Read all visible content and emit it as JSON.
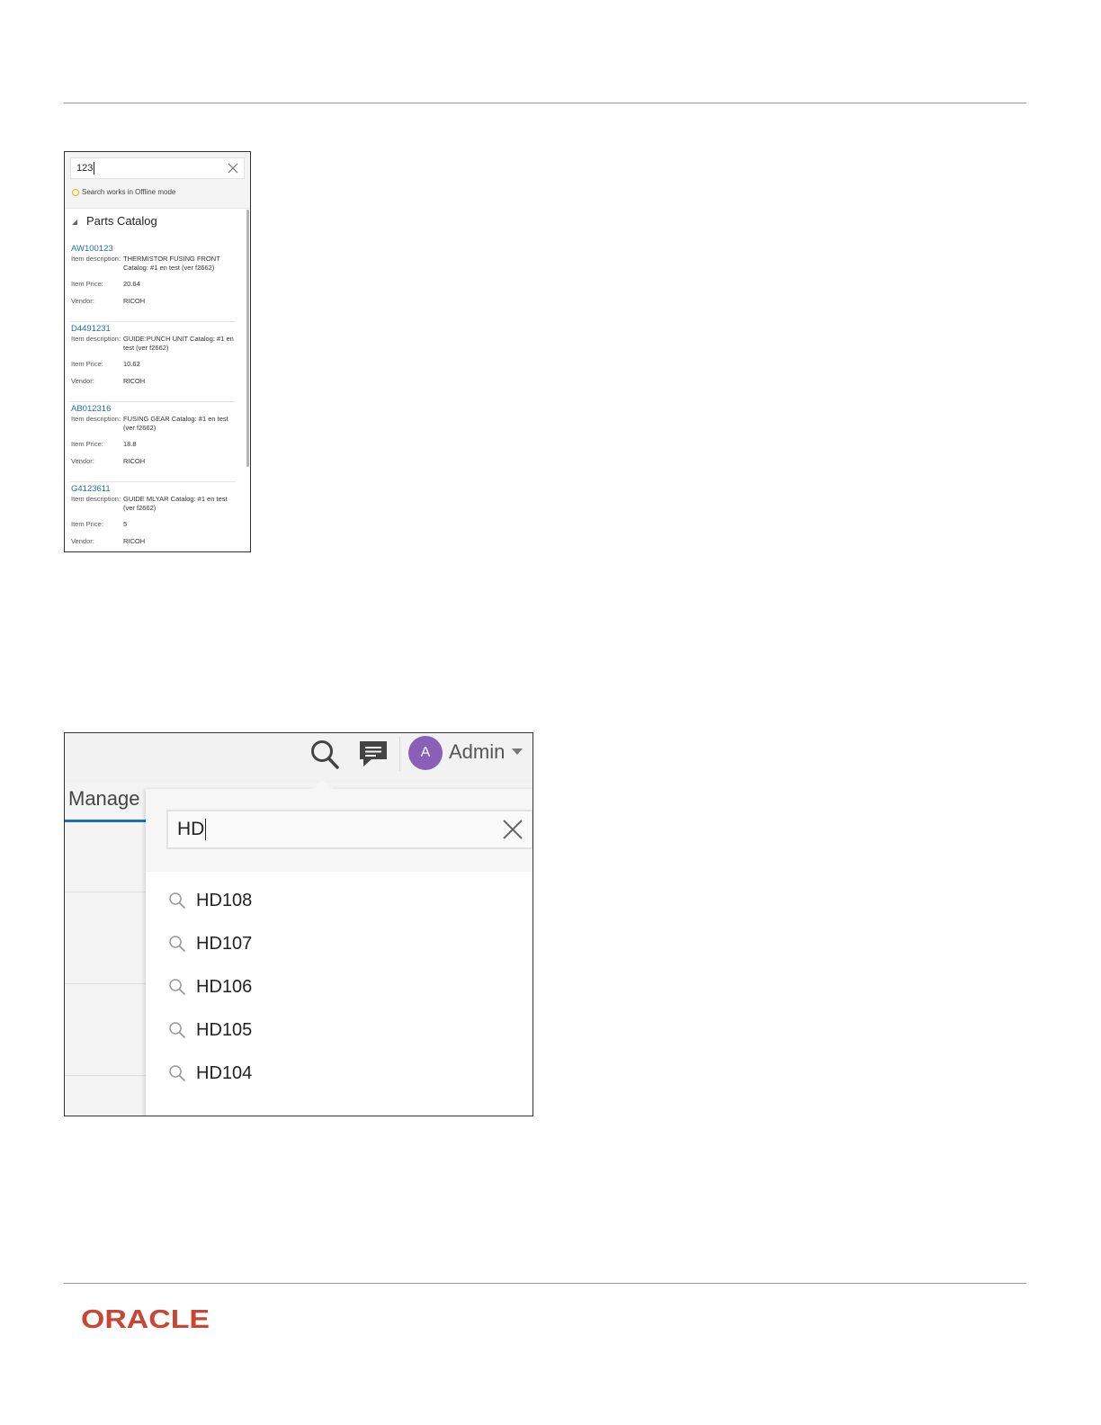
{
  "offline_search": {
    "query": "123",
    "hint": "Search works in Offline mode",
    "section_title": "Parts Catalog",
    "labels": {
      "description": "Item description:",
      "price": "Item Price:",
      "vendor": "Vendor:"
    },
    "items": [
      {
        "id": "AW100123",
        "description": "THERMISTOR FUSING FRONT Catalog: #1 en test (ver f2662)",
        "price": "20.64",
        "vendor": "RICOH"
      },
      {
        "id": "D4491231",
        "description": "GUIDE:PUNCH UNIT Catalog: #1 en test (ver f2662)",
        "price": "10.62",
        "vendor": "RICOH"
      },
      {
        "id": "AB012316",
        "description": "FUSING GEAR Catalog: #1 en test (ver f2662)",
        "price": "18.8",
        "vendor": "RICOH"
      },
      {
        "id": "G4123611",
        "description": "GUIDE MLYAR Catalog: #1 en test (ver f2662)",
        "price": "5",
        "vendor": "RICOH"
      }
    ]
  },
  "global_search": {
    "user_initial": "A",
    "user_name": "Admin",
    "tab_label": "Manage",
    "query": "HD",
    "suggestions": [
      "HD108",
      "HD107",
      "HD106",
      "HD105",
      "HD104"
    ],
    "avatar_color": "#8a5fb8",
    "accent_color": "#1e6fb8"
  },
  "footer": {
    "logo_text": "ORACLE",
    "logo_color": "#c74634"
  }
}
